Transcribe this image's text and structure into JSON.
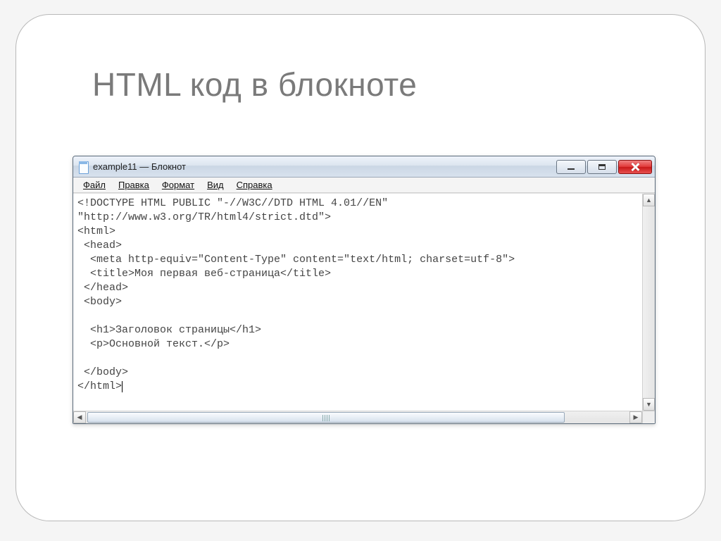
{
  "slide": {
    "title": "HTML код  в блокноте"
  },
  "window": {
    "title": "example11 — Блокнот"
  },
  "menu": {
    "file": "Файл",
    "edit": "Правка",
    "format": "Формат",
    "view": "Вид",
    "help": "Справка"
  },
  "code": {
    "lines": [
      "<!DOCTYPE HTML PUBLIC \"-//W3C//DTD HTML 4.01//EN\"",
      "\"http://www.w3.org/TR/html4/strict.dtd\">",
      "<html>",
      " <head>",
      "  <meta http-equiv=\"Content-Type\" content=\"text/html; charset=utf-8\">",
      "  <title>Моя первая веб-страница</title>",
      " </head>",
      " <body>",
      "",
      "  <h1>Заголовок страницы</h1>",
      "  <p>Основной текст.</p>",
      "",
      " </body>",
      "</html>"
    ]
  }
}
